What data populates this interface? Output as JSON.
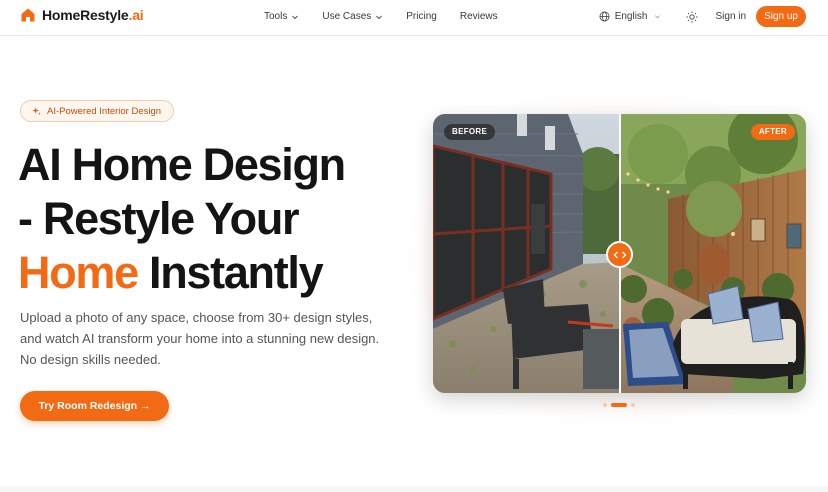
{
  "brand": {
    "name": "HomeRestyle",
    "suffix": ".ai",
    "accent": "#f26a14"
  },
  "nav": {
    "links": [
      {
        "label": "Tools",
        "dropdown": true
      },
      {
        "label": "Use Cases",
        "dropdown": true
      },
      {
        "label": "Pricing",
        "dropdown": false
      },
      {
        "label": "Reviews",
        "dropdown": false
      }
    ],
    "language": "English",
    "signin": "Sign in",
    "signup": "Sign up"
  },
  "hero": {
    "badge": "AI-Powered Interior Design",
    "title_line1": "AI Home Design",
    "title_line2": "- Restyle Your",
    "title_highlight": "Home",
    "title_line3_rest": " Instantly",
    "description": "Upload a photo of any space, choose from 30+ design styles, and watch AI transform your home into a stunning new design. No design skills needed.",
    "cta": "Try Room Redesign →"
  },
  "compare": {
    "before_label": "BEFORE",
    "after_label": "AFTER",
    "slider_position": 0.5
  },
  "carousel": {
    "count": 3,
    "active": 1
  }
}
